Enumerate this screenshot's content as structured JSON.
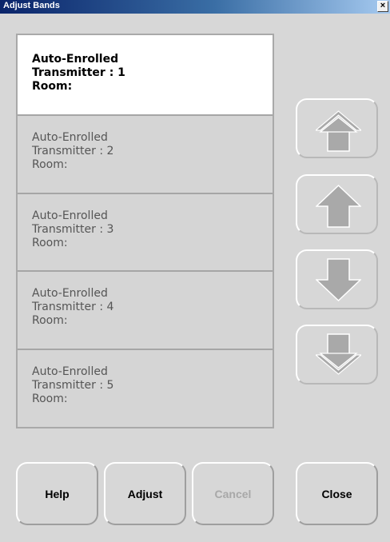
{
  "window": {
    "title": "Adjust Bands",
    "close_glyph": "×"
  },
  "bands": [
    {
      "line1": "Auto-Enrolled",
      "line2": "Transmitter : 1",
      "line3": "Room:",
      "selected": true
    },
    {
      "line1": "Auto-Enrolled",
      "line2": "Transmitter : 2",
      "line3": "Room:",
      "selected": false
    },
    {
      "line1": "Auto-Enrolled",
      "line2": "Transmitter : 3",
      "line3": "Room:",
      "selected": false
    },
    {
      "line1": "Auto-Enrolled",
      "line2": "Transmitter : 4",
      "line3": "Room:",
      "selected": false
    },
    {
      "line1": "Auto-Enrolled",
      "line2": "Transmitter : 5",
      "line3": "Room:",
      "selected": false
    }
  ],
  "side_buttons": {
    "move_top_icon": "double-up-arrow-icon",
    "move_up_icon": "up-arrow-icon",
    "move_down_icon": "down-arrow-icon",
    "move_bottom_icon": "double-down-arrow-icon"
  },
  "buttons": {
    "help": "Help",
    "adjust": "Adjust",
    "cancel": "Cancel",
    "close": "Close",
    "cancel_enabled": false
  },
  "colors": {
    "titlebar_start": "#0a246a",
    "titlebar_end": "#a6caf0",
    "background": "#d7d7d7",
    "selected_band": "#ffffff",
    "arrow_fill": "#a9a9a9",
    "disabled_text": "#a8a8a8"
  }
}
